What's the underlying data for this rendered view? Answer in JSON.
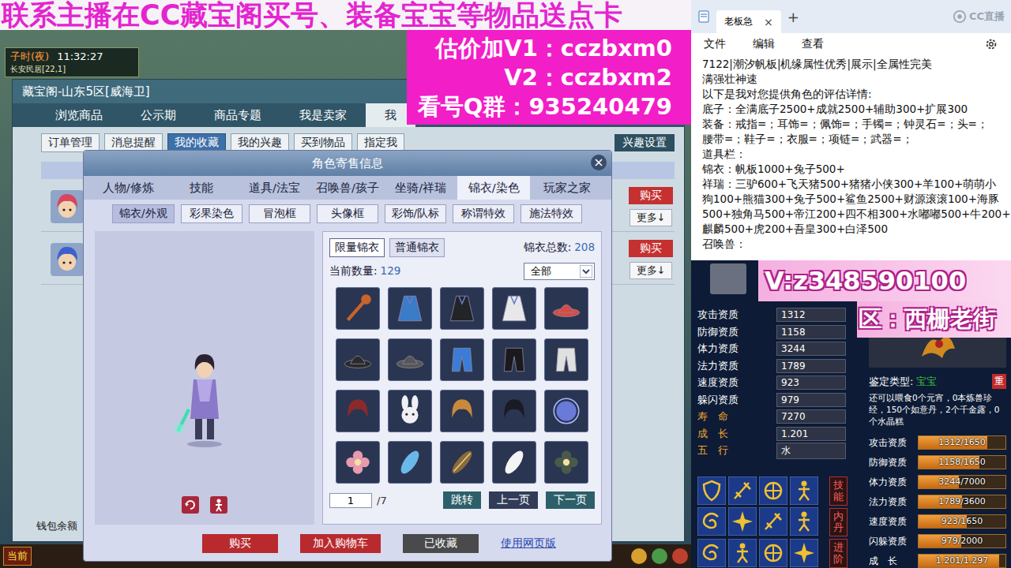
{
  "banner": {
    "text": "联系主播在CC藏宝阁买号、装备宝宝等物品送点卡"
  },
  "promo": {
    "lines": [
      "估价加V1：cczbxm0",
      "V2：cczbxm2",
      "看号Q群：935240479"
    ]
  },
  "game": {
    "hud": {
      "period": "子时(夜)",
      "clock": "11:32:27",
      "location": "长安民居[22,1]"
    },
    "window": {
      "title": "藏宝阁-山东5区[威海卫]"
    },
    "tabs": [
      {
        "label": "浏览商品",
        "selected": false
      },
      {
        "label": "公示期",
        "selected": false
      },
      {
        "label": "商品专题",
        "selected": false
      },
      {
        "label": "我是卖家",
        "selected": false
      },
      {
        "label": "我",
        "selected": true
      }
    ],
    "subtabs": [
      {
        "label": "订单管理",
        "selected": false
      },
      {
        "label": "消息提醒",
        "selected": false
      },
      {
        "label": "我的收藏",
        "selected": true
      },
      {
        "label": "我的兴趣",
        "selected": false
      },
      {
        "label": "买到物品",
        "selected": false
      },
      {
        "label": "指定我",
        "selected": false
      }
    ],
    "interest_button": "兴趣设置",
    "list_rows": [
      {
        "buy": "购买",
        "more": "更多↓",
        "color": "#d8455f"
      },
      {
        "buy": "购买",
        "more": "更多↓",
        "color": "#3f5fcf"
      }
    ],
    "wallet_label": "钱包余额",
    "chat_channel": "当前"
  },
  "modal": {
    "title": "角色寄售信息",
    "close": "×",
    "tabs": [
      {
        "label": "人物/修炼",
        "selected": false
      },
      {
        "label": "技能",
        "selected": false
      },
      {
        "label": "道具/法宝",
        "selected": false
      },
      {
        "label": "召唤兽/孩子",
        "selected": false
      },
      {
        "label": "坐骑/祥瑞",
        "selected": false
      },
      {
        "label": "锦衣/染色",
        "selected": true
      },
      {
        "label": "玩家之家",
        "selected": false
      }
    ],
    "subtabs": [
      {
        "label": "锦衣/外观",
        "selected": true
      },
      {
        "label": "彩果染色",
        "selected": false
      },
      {
        "label": "冒泡框",
        "selected": false
      },
      {
        "label": "头像框",
        "selected": false
      },
      {
        "label": "彩饰/队标",
        "selected": false
      },
      {
        "label": "称谓特效",
        "selected": false
      },
      {
        "label": "施法特效",
        "selected": false
      }
    ],
    "costume_tabs": [
      {
        "label": "限量锦衣",
        "selected": true
      },
      {
        "label": "普通锦衣",
        "selected": false
      }
    ],
    "total": {
      "label": "锦衣总数:",
      "value": "208"
    },
    "current": {
      "label": "当前数量:",
      "value": "129"
    },
    "filter": {
      "value": "全部"
    },
    "items": [
      {
        "kind": "weapon",
        "color": "#c8642a"
      },
      {
        "kind": "robe",
        "color": "#3a7cc8"
      },
      {
        "kind": "robe",
        "color": "#222428"
      },
      {
        "kind": "robe",
        "color": "#e8e8ea"
      },
      {
        "kind": "hat",
        "color": "#d84a4a"
      },
      {
        "kind": "hat",
        "color": "#2a2a2e"
      },
      {
        "kind": "hat",
        "color": "#55555c"
      },
      {
        "kind": "pants",
        "color": "#3a7cd8"
      },
      {
        "kind": "pants",
        "color": "#1a1a1e"
      },
      {
        "kind": "pants",
        "color": "#e0e0e0"
      },
      {
        "kind": "hair",
        "color": "#8a2a2a"
      },
      {
        "kind": "mask",
        "color": "#f0f0f4"
      },
      {
        "kind": "hair",
        "color": "#c88a3a"
      },
      {
        "kind": "hair",
        "color": "#1a1a22"
      },
      {
        "kind": "orb",
        "color": "#6a7ad8"
      },
      {
        "kind": "flower",
        "color": "#e89ab0"
      },
      {
        "kind": "feather",
        "color": "#6ab8e8"
      },
      {
        "kind": "board",
        "color": "#8a6a3a"
      },
      {
        "kind": "feather",
        "color": "#f4f4f4"
      },
      {
        "kind": "flower",
        "color": "#4a5a4a"
      }
    ],
    "pager": {
      "page": "1",
      "pages": "/7",
      "jump": "跳转",
      "prev": "上一页",
      "next": "下一页"
    },
    "actions": [
      {
        "label": "购买",
        "kind": "primary"
      },
      {
        "label": "加入购物车",
        "kind": "primary"
      },
      {
        "label": "已收藏",
        "kind": "muted"
      }
    ],
    "web_link": "使用网页版"
  },
  "notepad": {
    "tab": "老板急",
    "close": "×",
    "new_tab": "+",
    "menu": [
      "文件",
      "编辑",
      "查看"
    ],
    "watermark": "CC直播",
    "lines": [
      "7122|潮汐帆板|机缘属性优秀|展示|全属性完美",
      "满强壮神速",
      "以下是我对您提供角色的评估详情:",
      "底子：全满底子2500+成就2500+辅助300+扩展300",
      "装备：戒指=；耳饰=；佩饰=；手镯=；钟灵石=；头=；",
      "腰带=；鞋子=；衣服=；项链=；武器=；",
      "道具栏：",
      "锦衣：帆板1000+兔子500+",
      "祥瑞：三驴600+飞天猪500+猪猪小侠300+羊100+萌萌小",
      "狗100+熊猫300+兔子500+鲨鱼2500+财源滚滚100+海豚",
      "500+独角马500+帝江200+四不相300+水嘟嘟500+牛200+",
      "麒麟500+虎200+吾皇300+白泽500",
      "召唤兽："
    ]
  },
  "pet": {
    "overlay": {
      "contact": "V:z348590100",
      "server": "区：西栅老街"
    },
    "stats": [
      {
        "label": "攻击资质",
        "value": "1312",
        "accent": false
      },
      {
        "label": "防御资质",
        "value": "1158",
        "accent": false
      },
      {
        "label": "体力资质",
        "value": "3244",
        "accent": false
      },
      {
        "label": "法力资质",
        "value": "1789",
        "accent": false
      },
      {
        "label": "速度资质",
        "value": "923",
        "accent": false
      },
      {
        "label": "躲闪资质",
        "value": "979",
        "accent": false
      },
      {
        "label": "寿　命",
        "value": "7270",
        "accent": true
      },
      {
        "label": "成　长",
        "value": "1.201",
        "accent": true
      },
      {
        "label": "五　行",
        "value": "水",
        "accent": true
      }
    ],
    "skills": [
      {
        "kind": "shield"
      },
      {
        "kind": "blade"
      },
      {
        "kind": "wheel"
      },
      {
        "kind": "figure"
      },
      {
        "kind": "swirl"
      },
      {
        "kind": "spark"
      },
      {
        "kind": "blade"
      },
      {
        "kind": "figure"
      },
      {
        "kind": "swirl"
      },
      {
        "kind": "figure"
      },
      {
        "kind": "wheel"
      },
      {
        "kind": "spark"
      }
    ],
    "side_buttons": [
      "技能",
      "内丹",
      "进阶"
    ],
    "appraisal": {
      "label": "鉴定类型:",
      "value": "宝宝",
      "button": "重"
    },
    "feed_note": "还可以喂食0个元宵，0本炼兽珍经，150个如意丹，2个千金露，0个水晶糕",
    "bars": [
      {
        "label": "攻击资质",
        "reading": "1312/1650",
        "level": 0.795
      },
      {
        "label": "防御资质",
        "reading": "1158/1650",
        "level": 0.702
      },
      {
        "label": "体力资质",
        "reading": "3244/7000",
        "level": 0.463
      },
      {
        "label": "法力资质",
        "reading": "1789/3600",
        "level": 0.497
      },
      {
        "label": "速度资质",
        "reading": "923/1650",
        "level": 0.559
      },
      {
        "label": "闪躲资质",
        "reading": "979/2000",
        "level": 0.49
      },
      {
        "label": "成　长",
        "reading": "1.201/1.297",
        "level": 0.926
      }
    ]
  }
}
